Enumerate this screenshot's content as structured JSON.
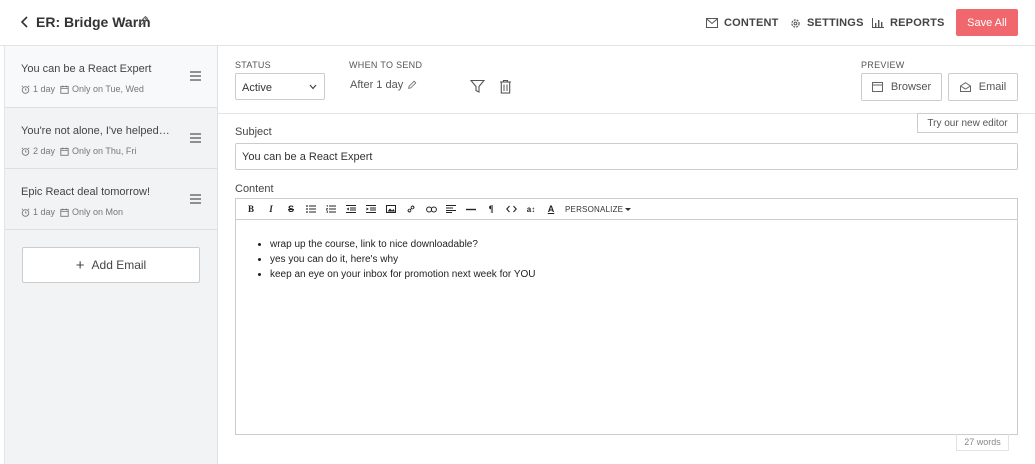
{
  "header": {
    "title": "ER: Bridge Warm",
    "nav": [
      {
        "label": "CONTENT",
        "icon": "envelope-icon"
      },
      {
        "label": "SETTINGS",
        "icon": "gear-icon"
      },
      {
        "label": "REPORTS",
        "icon": "bar-chart-icon"
      }
    ],
    "save_label": "Save All"
  },
  "sidebar": {
    "emails": [
      {
        "subject": "You can be a React Expert",
        "delay": "1 day",
        "schedule": "Only on Tue, Wed"
      },
      {
        "subject": "You're not alone, I've helped l...",
        "delay": "2 day",
        "schedule": "Only on Thu, Fri"
      },
      {
        "subject": "Epic React deal tomorrow!",
        "delay": "1 day",
        "schedule": "Only on Mon"
      }
    ],
    "add_label": "Add Email"
  },
  "settings": {
    "status_label": "STATUS",
    "status_value": "Active",
    "when_label": "WHEN TO SEND",
    "when_value": "After 1 day",
    "preview_label": "PREVIEW",
    "preview_browser": "Browser",
    "preview_email": "Email",
    "new_editor": "Try our new editor"
  },
  "editor": {
    "subject_label": "Subject",
    "subject_value": "You can be a React Expert",
    "content_label": "Content",
    "personalize": "PERSONALIZE",
    "body": [
      "wrap up the course, link to nice downloadable?",
      "yes you can do it, here's why",
      "keep an eye on your inbox for promotion next week for YOU"
    ],
    "word_count": "27 words"
  },
  "colors": {
    "accent": "#f0686d",
    "sidebar_bg": "#f1f3f5"
  }
}
